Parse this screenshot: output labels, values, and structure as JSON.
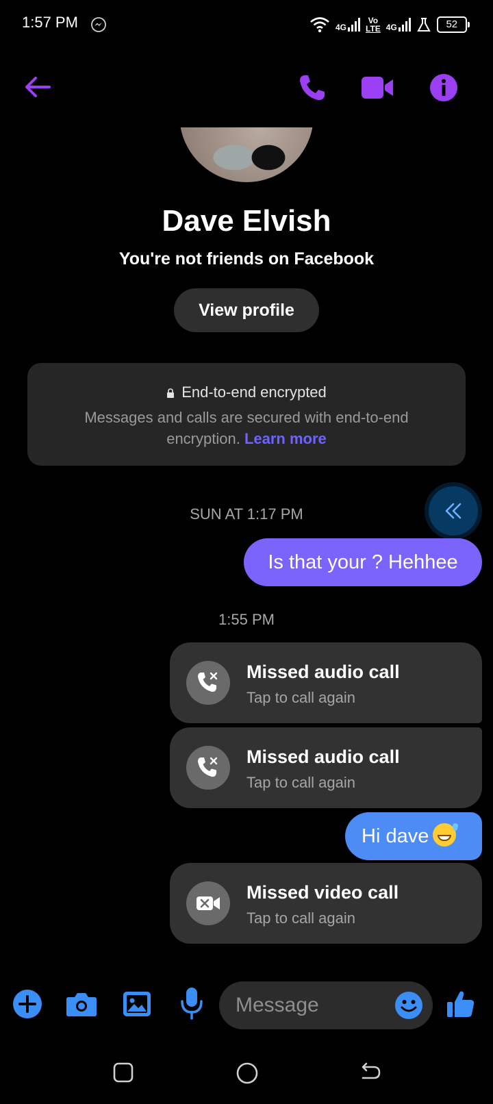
{
  "status_bar": {
    "time": "1:57 PM",
    "network_1": "4G",
    "network_vo": "Vo",
    "network_lte": "LTE",
    "network_2": "4G",
    "battery": "52"
  },
  "header": {
    "back_icon": "arrow-left-icon",
    "call_icon": "phone-icon",
    "video_icon": "video-camera-icon",
    "info_icon": "info-icon",
    "accent_color": "#9b3ff2"
  },
  "profile": {
    "name": "Dave Elvish",
    "friend_status": "You're not friends on Facebook",
    "view_profile_label": "View profile"
  },
  "encryption": {
    "title": "End-to-end encrypted",
    "description": "Messages and calls are secured with end-to-end encryption.",
    "learn_more": "Learn more"
  },
  "conversation": {
    "timestamp_1": "SUN AT 1:17 PM",
    "timestamp_2": "1:55 PM",
    "messages": [
      {
        "type": "outgoing_text",
        "text": "Is that your ? Hehhee",
        "color": "#7a64fb"
      },
      {
        "type": "missed_call",
        "title": "Missed audio call",
        "subtitle": "Tap to call again"
      },
      {
        "type": "missed_call",
        "title": "Missed audio call",
        "subtitle": "Tap to call again"
      },
      {
        "type": "outgoing_text",
        "text": "Hi dave",
        "emoji": "grinning-sweat-emoji",
        "color": "#4d8bf5"
      },
      {
        "type": "missed_video_call",
        "title": "Missed video call",
        "subtitle": "Tap to call again"
      }
    ]
  },
  "composer": {
    "placeholder": "Message",
    "icon_color": "#3b8ef5"
  }
}
